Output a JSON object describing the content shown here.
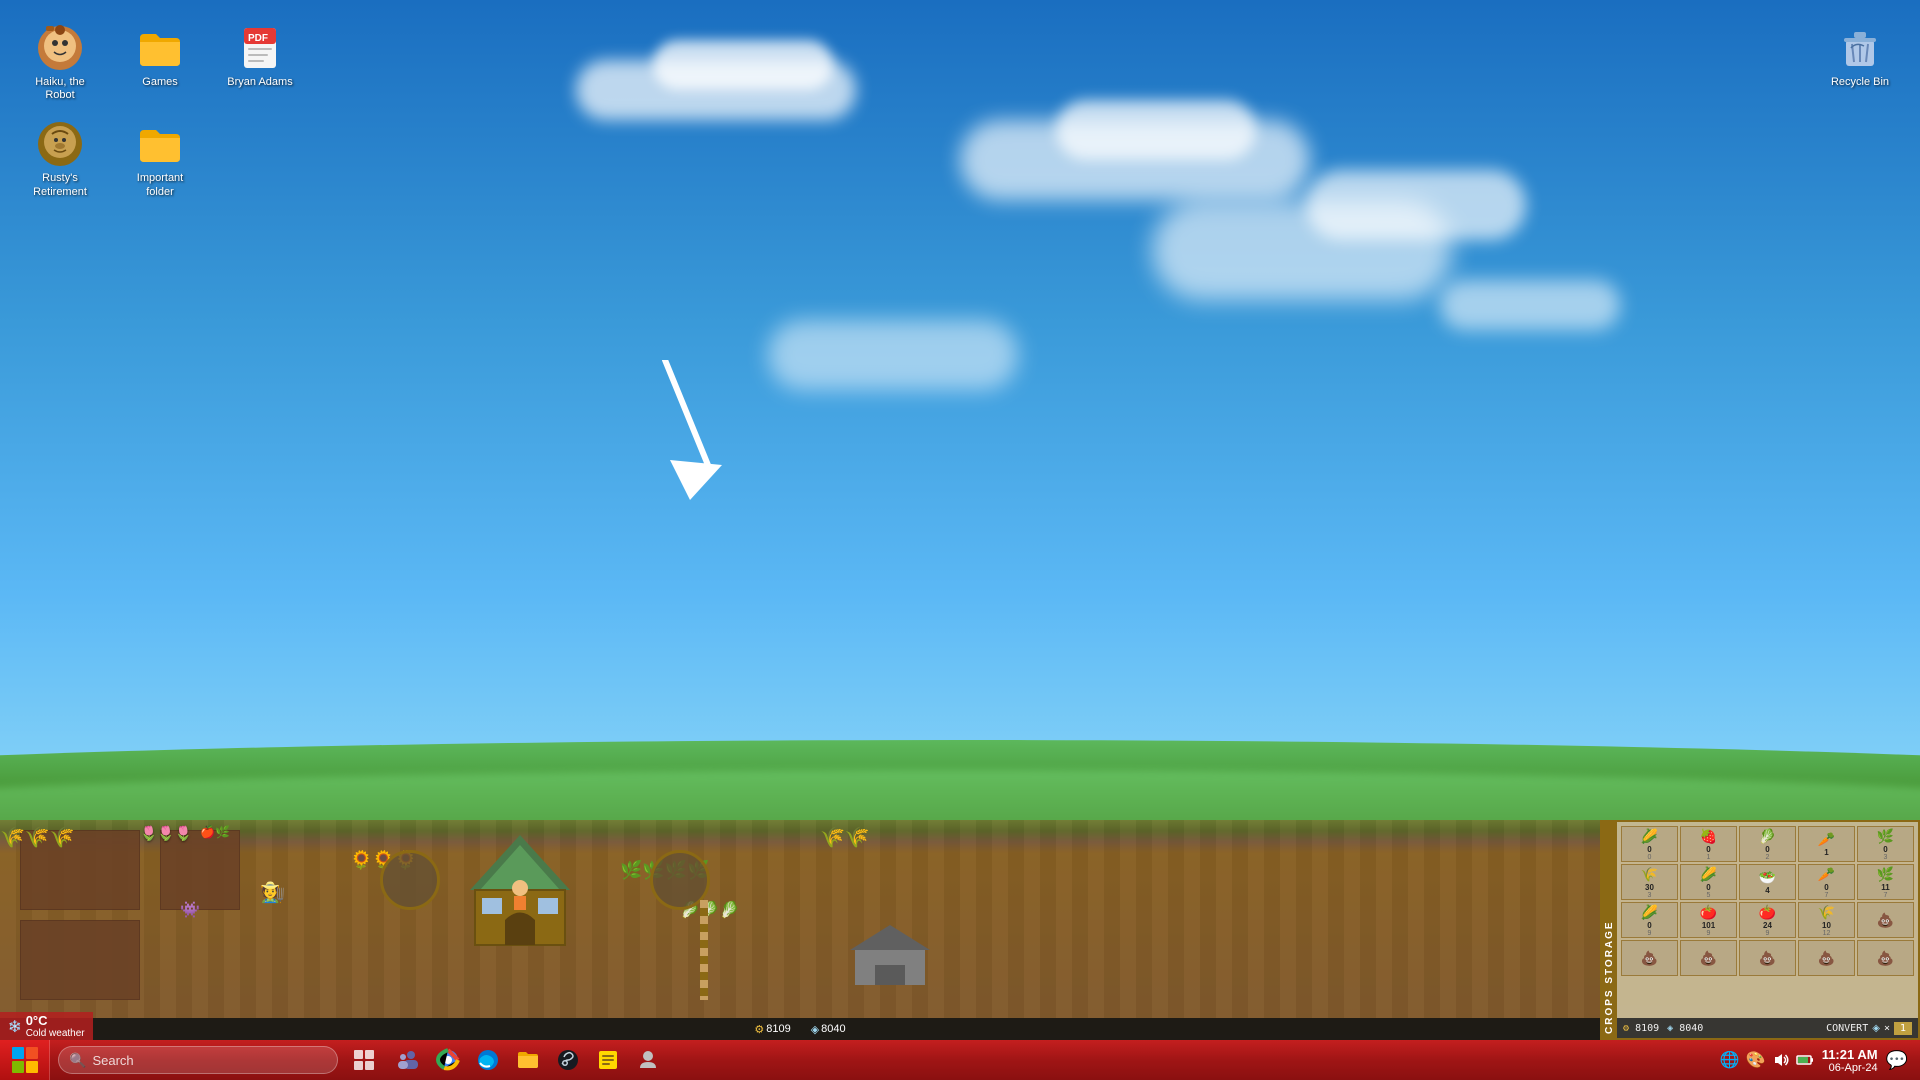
{
  "desktop": {
    "background": "bliss_xp_style"
  },
  "icons": {
    "row1": [
      {
        "id": "haiku-robot",
        "label": "Haiku, the Robot",
        "emoji": "🤖",
        "type": "app"
      },
      {
        "id": "games-folder",
        "label": "Games",
        "emoji": "📁",
        "type": "folder",
        "color": "#f0a800"
      },
      {
        "id": "bryan-adams",
        "label": "Bryan Adams",
        "emoji": "📄",
        "type": "pdf"
      }
    ],
    "row2": [
      {
        "id": "rustys-retirement",
        "label": "Rusty's\nRetirement",
        "emoji": "🌾",
        "type": "app"
      },
      {
        "id": "important-folder",
        "label": "Important folder",
        "emoji": "📁",
        "type": "folder",
        "color": "#f0a800"
      }
    ]
  },
  "recycle_bin": {
    "label": "Recycle Bin",
    "emoji": "🗑️"
  },
  "game": {
    "currency1_icon": "⚙",
    "currency1_value": "8109",
    "currency2_icon": "◈",
    "currency2_value": "8040",
    "hud_currency1": "8109",
    "hud_currency2": "8040",
    "convert_label": "CONVERT",
    "convert_value": "1",
    "crops_storage_label": "CROPS STORAGE",
    "crops": [
      {
        "icon": "🌽",
        "count": "0",
        "sub": "0"
      },
      {
        "icon": "🍓",
        "count": "0",
        "sub": "1"
      },
      {
        "icon": "🥬",
        "count": "0",
        "sub": "2"
      },
      {
        "icon": "🥕",
        "count": "1",
        "sub": ""
      },
      {
        "icon": "🌿",
        "count": "0",
        "sub": "3"
      },
      {
        "icon": "🌾",
        "count": "30",
        "sub": "3"
      },
      {
        "icon": "🌽",
        "count": "0",
        "sub": "5"
      },
      {
        "icon": "🥗",
        "count": "4",
        "sub": ""
      },
      {
        "icon": "🥕",
        "count": "0",
        "sub": "7"
      },
      {
        "icon": "🌿",
        "count": "11",
        "sub": "7"
      },
      {
        "icon": "🌽",
        "count": "0",
        "sub": "9"
      },
      {
        "icon": "🍅",
        "count": "101",
        "sub": "9"
      },
      {
        "icon": "🍅",
        "count": "24",
        "sub": "9"
      },
      {
        "icon": "🌾",
        "count": "10",
        "sub": "12"
      },
      {
        "icon": "💩",
        "count": "",
        "sub": ""
      },
      {
        "icon": "💩",
        "count": "",
        "sub": ""
      },
      {
        "icon": "💩",
        "count": "",
        "sub": ""
      },
      {
        "icon": "💩",
        "count": "",
        "sub": ""
      },
      {
        "icon": "💩",
        "count": "",
        "sub": ""
      },
      {
        "icon": "💩",
        "count": "",
        "sub": ""
      }
    ]
  },
  "taskbar": {
    "search_placeholder": "Search",
    "icons": [
      "🖥️",
      "💬",
      "🌐",
      "🦊",
      "📁",
      "🎮",
      "📝",
      "👤"
    ],
    "time": "11:21 AM",
    "date": "06-Apr-24",
    "tray_icons": [
      "🌐",
      "🎨"
    ]
  },
  "weather": {
    "temp": "0°C",
    "condition": "Cold weather",
    "icon": "❄️"
  }
}
